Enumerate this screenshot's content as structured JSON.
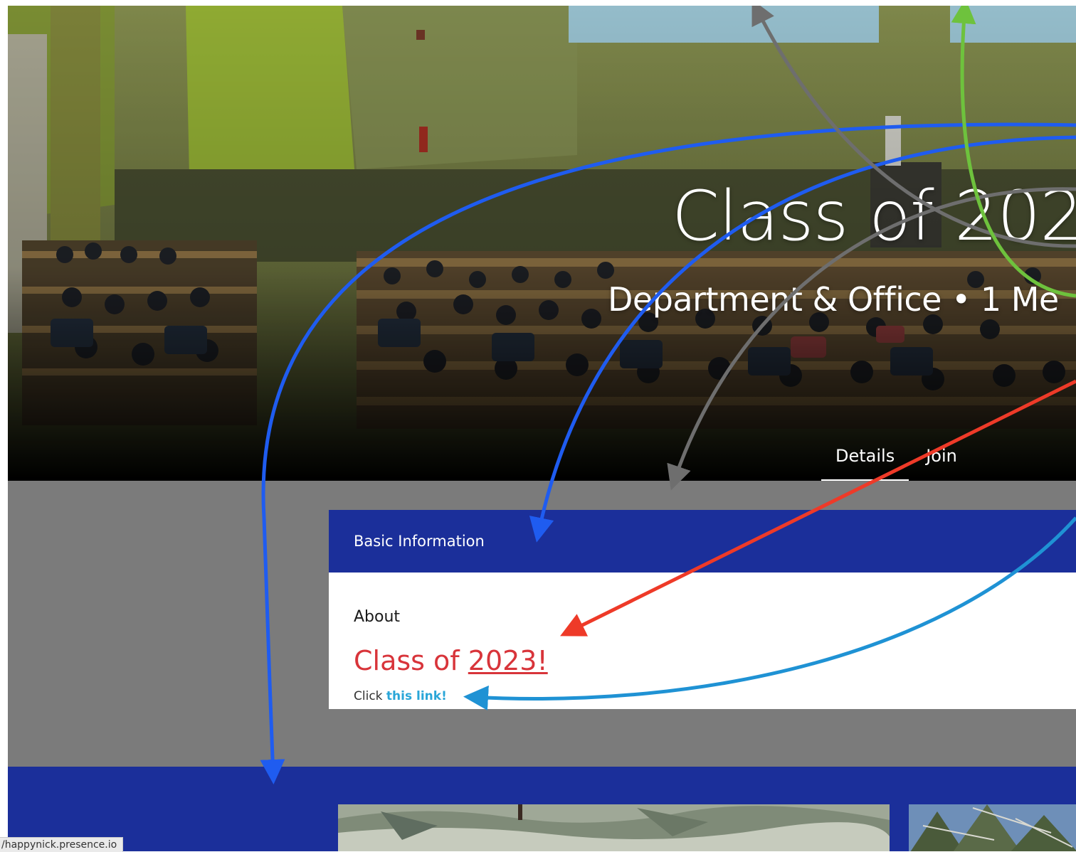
{
  "hero": {
    "title": "Class of 202",
    "subtitle": "Department & Office • 1 Me",
    "tabs": [
      {
        "label": "Details",
        "active": true
      },
      {
        "label": "Join",
        "active": false
      }
    ]
  },
  "card": {
    "header": "Basic Information",
    "about_label": "About",
    "heading_text": "Class of ",
    "heading_link": "2023!",
    "click_prefix": "Click ",
    "click_link": "this link!"
  },
  "status_bar": {
    "url": "/happynick.presence.io"
  },
  "colors": {
    "brand_blue": "#1b2f9a",
    "heading_red": "#d8343a",
    "link_blue": "#2aa6d8",
    "annotation_blue": "#1f5cf0",
    "annotation_light_blue": "#1f92d4",
    "annotation_red": "#ee3a28",
    "annotation_gray": "#6e6e6e",
    "annotation_green": "#6ec23d"
  },
  "annotation_arrows": [
    {
      "color": "annotation_blue",
      "target": "bottom-band"
    },
    {
      "color": "annotation_blue",
      "target": "card-header"
    },
    {
      "color": "annotation_gray",
      "target": "card-top"
    },
    {
      "color": "annotation_red",
      "target": "class-heading"
    },
    {
      "color": "annotation_light_blue",
      "target": "click-link"
    },
    {
      "color": "annotation_gray",
      "target": "off-screen-top"
    },
    {
      "color": "annotation_green",
      "target": "off-screen-top"
    }
  ]
}
